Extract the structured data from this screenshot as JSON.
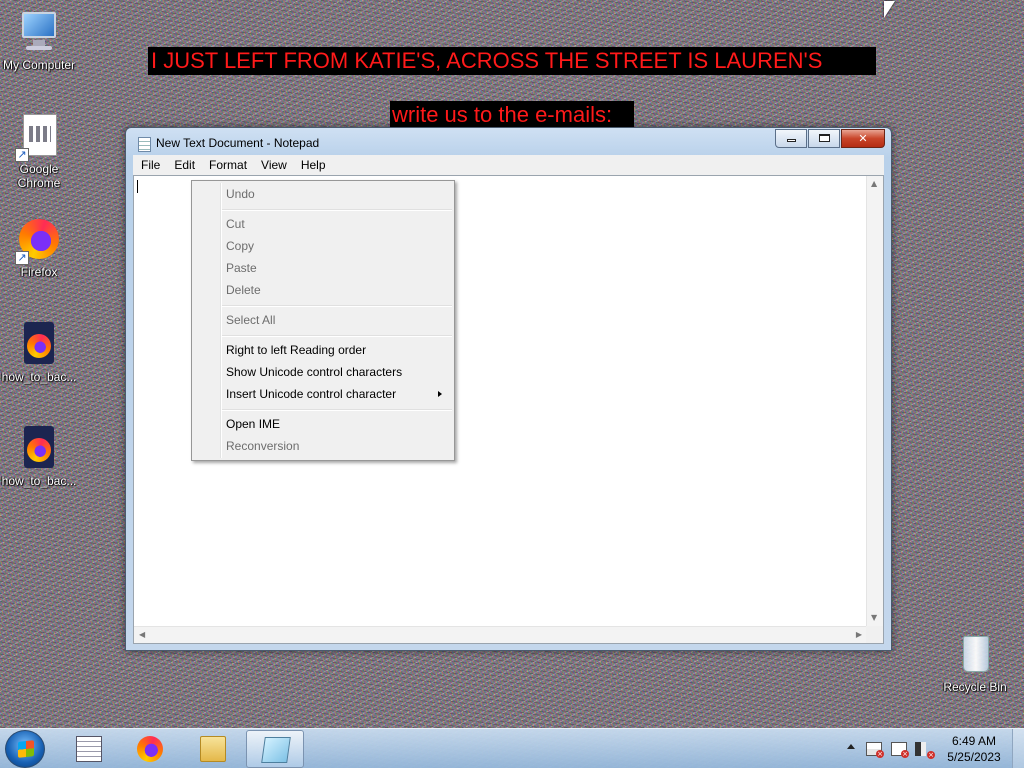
{
  "banners": {
    "line1": "I JUST LEFT FROM KATIE'S, ACROSS THE STREET IS LAUREN'S",
    "line2": "write us to the e-mails:"
  },
  "desktop": {
    "icons": [
      {
        "label": "My Computer",
        "icon": "computer-icon"
      },
      {
        "label": "Google Chrome",
        "icon": "chrome-shortcut-icon"
      },
      {
        "label": "Firefox",
        "icon": "firefox-icon"
      },
      {
        "label": "how_to_bac...",
        "icon": "firefox-file-icon"
      },
      {
        "label": "how_to_bac...",
        "icon": "firefox-file-icon"
      },
      {
        "label": "Recycle Bin",
        "icon": "recycle-bin-icon"
      }
    ]
  },
  "window": {
    "title": "New Text Document - Notepad",
    "menu": [
      "File",
      "Edit",
      "Format",
      "View",
      "Help"
    ]
  },
  "context_menu": {
    "items": [
      {
        "label": "Undo",
        "enabled": false
      },
      {
        "label": "Cut",
        "enabled": false
      },
      {
        "label": "Copy",
        "enabled": false
      },
      {
        "label": "Paste",
        "enabled": false
      },
      {
        "label": "Delete",
        "enabled": false
      },
      {
        "label": "Select All",
        "enabled": false
      },
      {
        "label": "Right to left Reading order",
        "enabled": true
      },
      {
        "label": "Show Unicode control characters",
        "enabled": true
      },
      {
        "label": "Insert Unicode control character",
        "enabled": true,
        "submenu": true
      },
      {
        "label": "Open IME",
        "enabled": true
      },
      {
        "label": "Reconversion",
        "enabled": false
      }
    ]
  },
  "taskbar": {
    "clock_time": "6:49 AM",
    "clock_date": "5/25/2023"
  },
  "colors": {
    "banner_text": "#ff1a1a",
    "banner_bg": "#000000"
  }
}
